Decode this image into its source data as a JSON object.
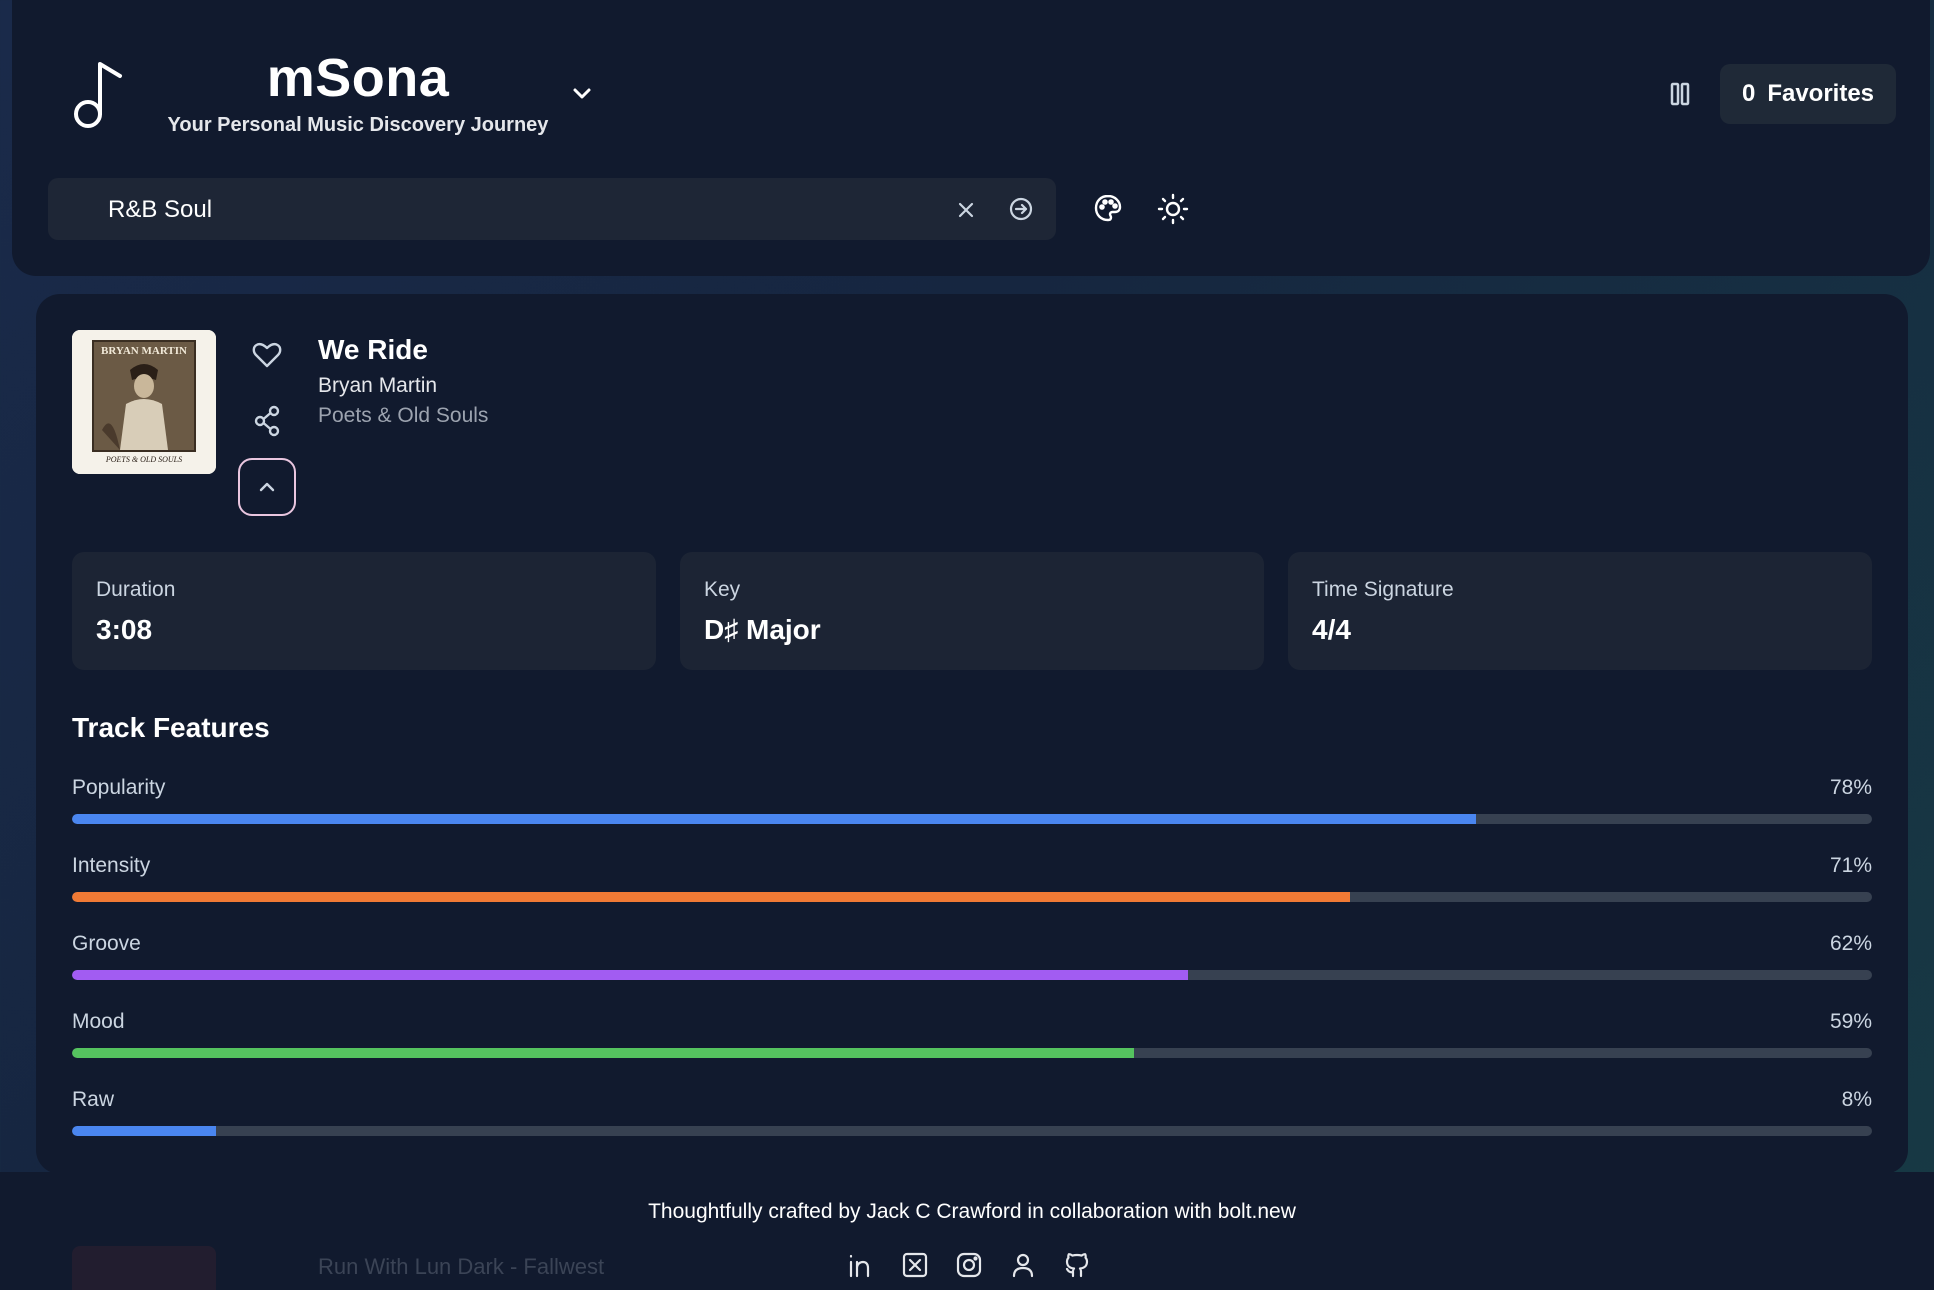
{
  "header": {
    "brand_title": "mSona",
    "brand_subtitle": "Your Personal Music Discovery Journey",
    "favorites_count": "0",
    "favorites_label": "Favorites"
  },
  "search": {
    "value": "R&B Soul"
  },
  "track": {
    "title": "We Ride",
    "artist": "Bryan Martin",
    "album": "Poets & Old Souls",
    "album_art_text_top": "BRYAN MARTIN",
    "album_art_text_bottom": "POETS & OLD SOULS"
  },
  "stats": [
    {
      "label": "Duration",
      "value": "3:08"
    },
    {
      "label": "Key",
      "value": "D♯ Major"
    },
    {
      "label": "Time Signature",
      "value": "4/4"
    }
  ],
  "features": {
    "title": "Track Features",
    "items": [
      {
        "label": "Popularity",
        "pct": "78%",
        "value": 78,
        "color": "#4a86f0"
      },
      {
        "label": "Intensity",
        "pct": "71%",
        "value": 71,
        "color": "#f07a35"
      },
      {
        "label": "Groove",
        "pct": "62%",
        "value": 62,
        "color": "#a25cf2"
      },
      {
        "label": "Mood",
        "pct": "59%",
        "value": 59,
        "color": "#55c35f"
      },
      {
        "label": "Raw",
        "pct": "8%",
        "value": 8,
        "color": "#4a86f0"
      }
    ]
  },
  "footer": {
    "credit": "Thoughtfully crafted by Jack C Crawford in collaboration with bolt.new",
    "ghost_text": "Run With Lun Dark - Fallwest",
    "socials": [
      "linkedin-icon",
      "x-icon",
      "instagram-icon",
      "user-icon",
      "github-icon"
    ]
  },
  "colors": {
    "background": "#111a2e",
    "panel": "#1c2434",
    "accent_border": "#e9c6df"
  }
}
